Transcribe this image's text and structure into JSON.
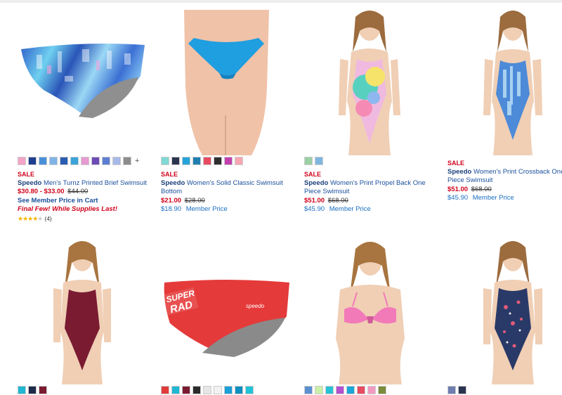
{
  "products": [
    {
      "sale": "SALE",
      "brand": "Speedo",
      "name": "Men's Turnz Printed Brief Swimsuit",
      "price": "$30.80 - $33.00",
      "original_price": "$44.00",
      "member_link": "See Member Price in Cart",
      "promo": "Final Few! While Supplies Last!",
      "rating_count": "(4)",
      "rating": 3.5,
      "swatches": [
        "#f5a3c7",
        "#1d3f8f",
        "#4a90d9",
        "#7fb3e6",
        "#2a5db0",
        "#3aa3d8",
        "#e79ad2",
        "#6d4bb5",
        "#5c7fd1",
        "#a7b9e8",
        "#8c8c8c"
      ],
      "more": "+"
    },
    {
      "sale": "SALE",
      "brand": "Speedo",
      "name": "Women's Solid Classic Swimsuit Bottom",
      "price": "$21.00",
      "original_price": "$28.00",
      "member_price": "$18.90",
      "member_label": "Member Price",
      "swatches": [
        "#7fd9d4",
        "#2c3550",
        "#23a3d8",
        "#1f7fb0",
        "#e84a5f",
        "#2f2f2f",
        "#c23fb0",
        "#f7a6b2"
      ]
    },
    {
      "sale": "SALE",
      "brand": "Speedo",
      "name": "Women's Print Propel Back One Piece Swimsuit",
      "price": "$51.00",
      "original_price": "$68.00",
      "member_price": "$45.90",
      "member_label": "Member Price",
      "swatches": [
        "#9ad0a4",
        "#7fb6e0"
      ]
    },
    {
      "sale": "SALE",
      "brand": "Speedo",
      "name": "Women's Print Crossback One Piece Swimsuit",
      "price": "$51.00",
      "original_price": "$68.00",
      "member_price": "$45.90",
      "member_label": "Member Price"
    },
    {
      "swatches": [
        "#1fb7d1",
        "#1e2a4a",
        "#7a1b32"
      ]
    },
    {
      "swatches": [
        "#e23b3b",
        "#1fb7d1",
        "#7a1b32",
        "#2a2a2a",
        "#e6e6e6",
        "#f2f2f2",
        "#1a9fd8",
        "#0e8fc0",
        "#1fc3d6"
      ]
    },
    {
      "swatches": [
        "#5b8fd0",
        "#c9f0a8",
        "#27c1d6",
        "#b34fd0",
        "#1aa6d8",
        "#e84a5f",
        "#f29ac0",
        "#7a8c3b"
      ]
    },
    {
      "swatches": [
        "#6f7db0",
        "#2a3450"
      ]
    }
  ]
}
